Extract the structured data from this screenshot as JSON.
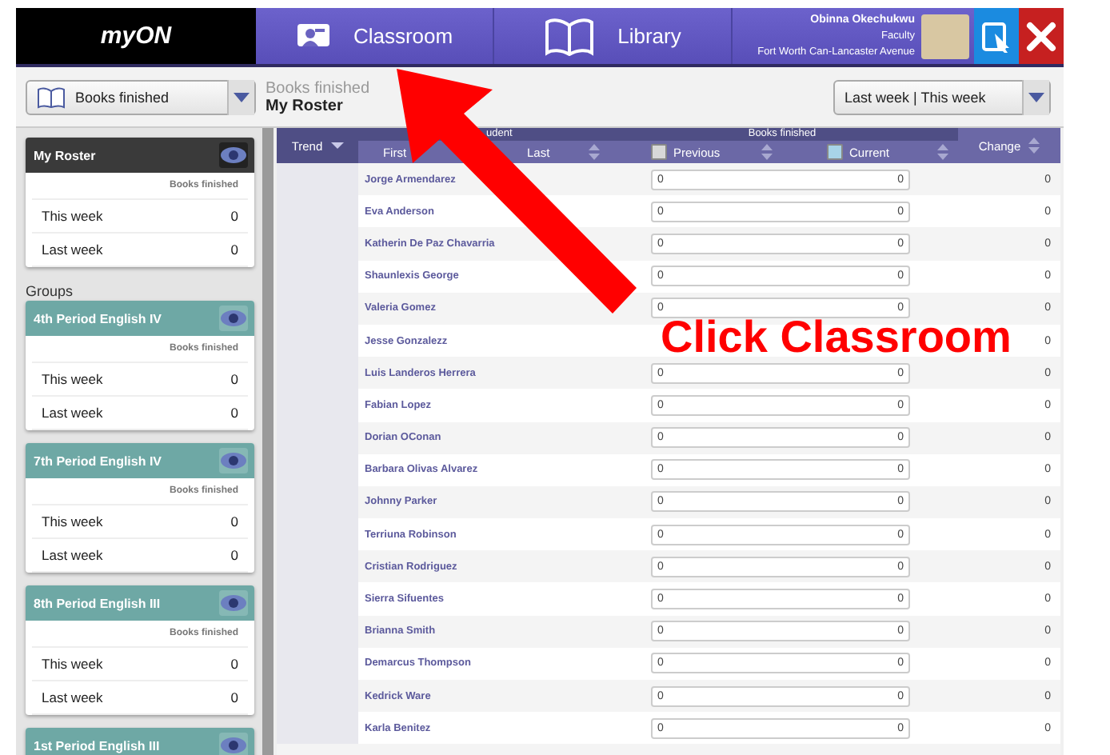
{
  "header": {
    "logo": "myON",
    "tabs": [
      {
        "label": "Classroom",
        "kind": "classroom",
        "selected": false
      },
      {
        "label": "Library",
        "kind": "library",
        "selected": false
      }
    ],
    "user": {
      "name": "Obinna Okechukwu",
      "role": "Faculty",
      "school": "Fort Worth Can-Lancaster Avenue"
    }
  },
  "toolbar": {
    "metric_dropdown": "Books finished",
    "context_title": "Books finished",
    "context_subtitle": "My Roster",
    "range_dropdown": "Last week | This week"
  },
  "sidebar": {
    "roster": {
      "title": "My Roster",
      "column": "Books finished",
      "rows": [
        {
          "label": "This week",
          "value": "0"
        },
        {
          "label": "Last week",
          "value": "0"
        }
      ]
    },
    "groups_label": "Groups",
    "groups": [
      {
        "title": "4th Period English IV",
        "column": "Books finished",
        "rows": [
          {
            "label": "This week",
            "value": "0"
          },
          {
            "label": "Last week",
            "value": "0"
          }
        ]
      },
      {
        "title": "7th Period English IV",
        "column": "Books finished",
        "rows": [
          {
            "label": "This week",
            "value": "0"
          },
          {
            "label": "Last week",
            "value": "0"
          }
        ]
      },
      {
        "title": "8th Period English III",
        "column": "Books finished",
        "rows": [
          {
            "label": "This week",
            "value": "0"
          },
          {
            "label": "Last week",
            "value": "0"
          }
        ]
      },
      {
        "title": "1st Period English III"
      }
    ]
  },
  "table": {
    "columns": {
      "trend": "Trend",
      "student": "udent",
      "first": "First",
      "last": "Last",
      "books": "Books finished",
      "previous": "Previous",
      "current": "Current",
      "change": "Change"
    },
    "rows": [
      {
        "name": "Jorge Armendarez",
        "previous": "0",
        "current": "0",
        "change": "0"
      },
      {
        "name": "Eva Anderson",
        "previous": "0",
        "current": "0",
        "change": "0"
      },
      {
        "name": "Katherin De Paz Chavarria",
        "previous": "0",
        "current": "0",
        "change": "0"
      },
      {
        "name": "Shaunlexis George",
        "previous": "0",
        "current": "0",
        "change": "0"
      },
      {
        "name": "Valeria Gomez",
        "previous": "0",
        "current": "0",
        "change": "0"
      },
      {
        "name": "Jesse Gonzalezz",
        "change": "0"
      },
      {
        "name": "Luis Landeros Herrera",
        "previous": "0",
        "current": "0",
        "change": "0"
      },
      {
        "name": "Fabian Lopez",
        "previous": "0",
        "current": "0",
        "change": "0"
      },
      {
        "name": "Dorian OConan",
        "previous": "0",
        "current": "0",
        "change": "0"
      },
      {
        "name": "Barbara Olivas Alvarez",
        "previous": "0",
        "current": "0",
        "change": "0"
      },
      {
        "name": "Johnny Parker",
        "previous": "0",
        "current": "0",
        "change": "0"
      },
      {
        "name": "Terriuna Robinson",
        "previous": "0",
        "current": "0",
        "change": "0"
      },
      {
        "name": "Cristian Rodriguez",
        "previous": "0",
        "current": "0",
        "change": "0"
      },
      {
        "name": "Sierra Sifuentes",
        "previous": "0",
        "current": "0",
        "change": "0"
      },
      {
        "name": "Brianna Smith",
        "previous": "0",
        "current": "0",
        "change": "0"
      },
      {
        "name": "Demarcus Thompson",
        "previous": "0",
        "current": "0",
        "change": "0"
      },
      {
        "name": "Kedrick Ware",
        "previous": "0",
        "current": "0",
        "change": "0"
      },
      {
        "name": "Karla Benitez",
        "previous": "0",
        "current": "0",
        "change": "0"
      }
    ]
  },
  "annotation": {
    "text": "Click Classroom"
  }
}
